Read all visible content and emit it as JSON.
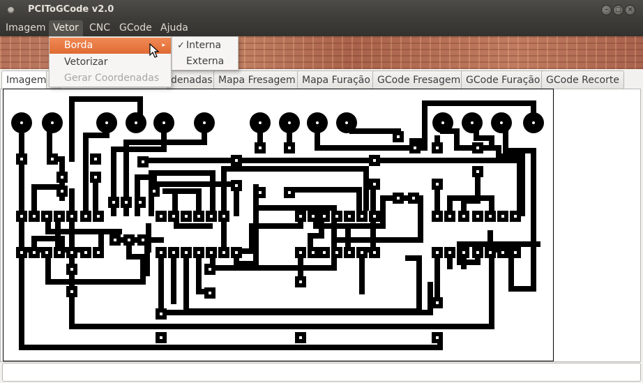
{
  "window": {
    "title": "PCIToGCode  v2.0"
  },
  "menubar": {
    "items": [
      {
        "label": "Imagem"
      },
      {
        "label": "Vetor"
      },
      {
        "label": "CNC"
      },
      {
        "label": "GCode"
      },
      {
        "label": "Ajuda"
      }
    ]
  },
  "vetor_menu": {
    "items": [
      {
        "label": "Borda",
        "has_submenu": true
      },
      {
        "label": "Vetorizar"
      },
      {
        "label": "Gerar Coordenadas",
        "disabled": true
      }
    ]
  },
  "borda_submenu": {
    "items": [
      {
        "label": "Interna",
        "checked": true
      },
      {
        "label": "Externa"
      }
    ]
  },
  "tabs": [
    {
      "label": "Imagem"
    },
    {
      "label": "denadas"
    },
    {
      "label": "Mapa Fresagem"
    },
    {
      "label": "Mapa Furação"
    },
    {
      "label": "GCode Fresagem"
    },
    {
      "label": "GCode Furação"
    },
    {
      "label": "GCode Recorte"
    }
  ],
  "colors": {
    "accent": "#e06b33",
    "titlebar": "#3c3b37",
    "trace": "#000000"
  },
  "icons": {
    "check": "✓",
    "submenu_arrow": "▸"
  }
}
